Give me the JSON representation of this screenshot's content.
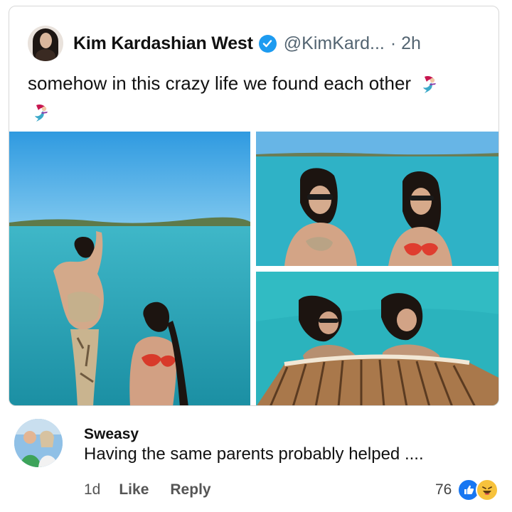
{
  "tweet": {
    "author_name": "Kim Kardashian West",
    "handle": "@KimKard...",
    "separator_time": "· 2h",
    "text": "somehow in this crazy life we found each other",
    "emojis": [
      "mermaid-icon",
      "mermaid-icon"
    ],
    "verified_icon": "verified-badge-icon",
    "verified_color": "#1d9bf0"
  },
  "comment": {
    "author": "Sweasy",
    "text": "Having the same parents probably helped ....",
    "time": "1d",
    "like_label": "Like",
    "reply_label": "Reply",
    "reaction_count": "76",
    "reactions": [
      "like-reaction-icon",
      "haha-reaction-icon"
    ]
  },
  "colors": {
    "sea": "#2ab6c4",
    "sky": "#3fa3e0",
    "like_blue": "#1877f2",
    "haha_yellow": "#f7c23c"
  }
}
